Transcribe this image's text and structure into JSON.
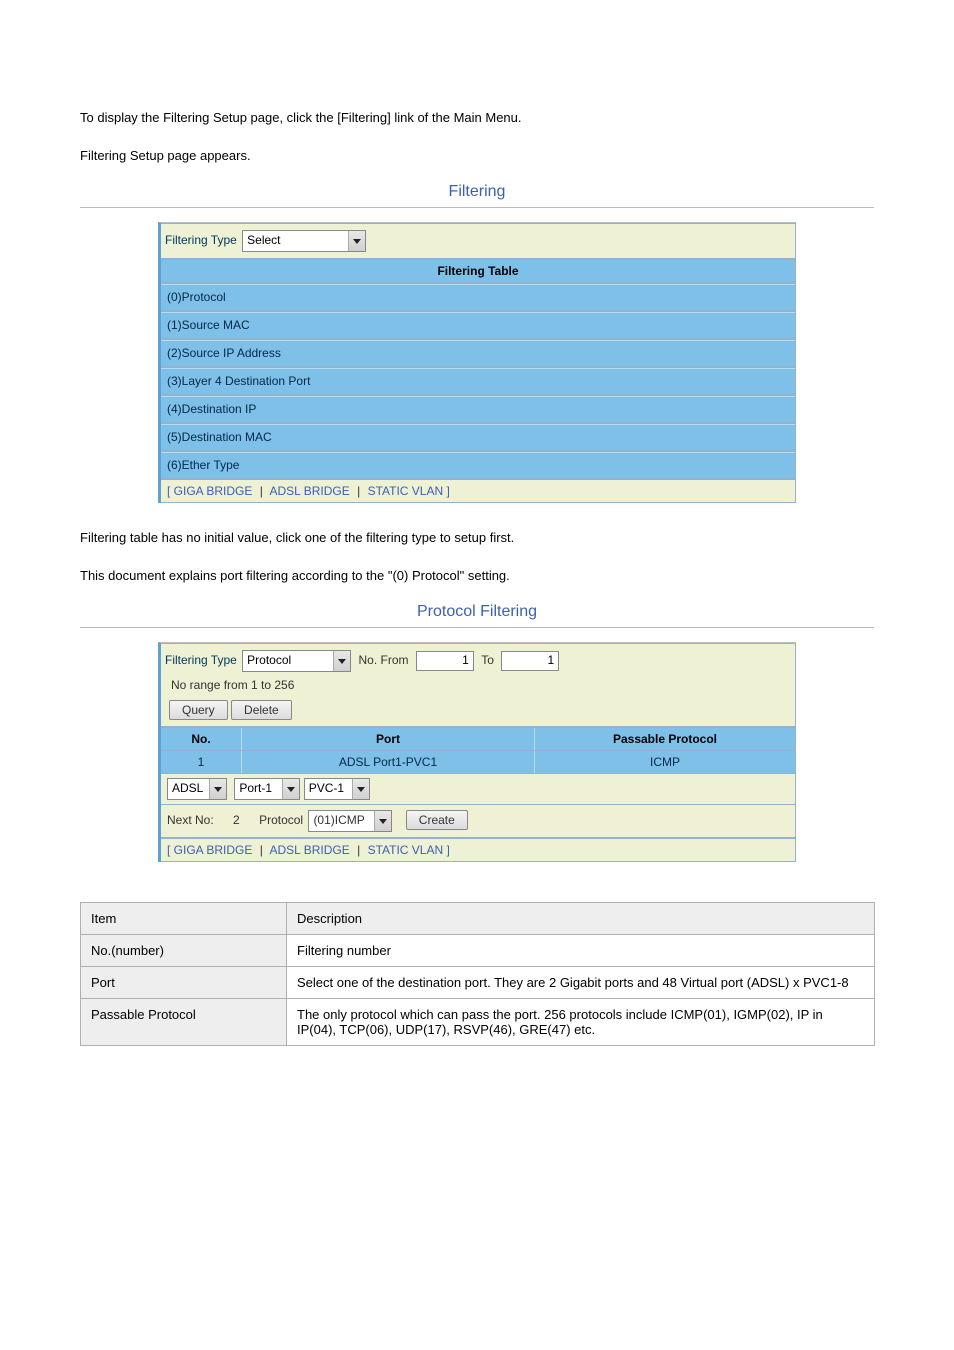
{
  "intro": {
    "line1": "To display the Filtering Setup page, click the [Filtering] link of the Main Menu.",
    "line2": "Filtering Setup page appears."
  },
  "panel1": {
    "title": "Filtering",
    "filteringTypeLabel": "Filtering Type",
    "filteringTypeValue": "Select",
    "tableTitle": "Filtering Table",
    "rows": [
      "(0)Protocol",
      "(1)Source MAC",
      "(2)Source IP Address",
      "(3)Layer 4 Destination Port",
      "(4)Destination IP",
      "(5)Destination MAC",
      "(6)Ether Type"
    ],
    "footer": {
      "bracketOpen": "[ ",
      "link1": "GIGA BRIDGE",
      "link2": "ADSL BRIDGE",
      "link3": "STATIC VLAN",
      "bracketClose": " ]"
    }
  },
  "mid": {
    "line1": "Filtering table has no initial value, click one of the filtering type to setup first.",
    "line2": "This document explains port filtering according to the \"(0) Protocol\" setting."
  },
  "panel2": {
    "title": "Protocol Filtering",
    "filteringTypeLabel": "Filtering Type",
    "filteringTypeValue": "Protocol",
    "noFromLabel": "No. From",
    "noFromValue": "1",
    "toLabel": "To",
    "toValue": "1",
    "rangeHint": "No range from 1 to 256",
    "queryBtn": "Query",
    "deleteBtn": "Delete",
    "headers": {
      "no": "No.",
      "port": "Port",
      "prot": "Passable Protocol"
    },
    "dataRow": {
      "no": "1",
      "port": "ADSL Port1-PVC1",
      "prot": "ICMP"
    },
    "selects": {
      "adsl": "ADSL",
      "port": "Port-1",
      "pvc": "PVC-1"
    },
    "nextNoLabel": "Next No:",
    "nextNoVal": "2",
    "protocolLabel": "Protocol",
    "protocolValue": "(01)ICMP",
    "createBtn": "Create",
    "footer": {
      "bracketOpen": "[ ",
      "link1": "GIGA BRIDGE",
      "link2": "ADSL BRIDGE",
      "link3": "STATIC VLAN",
      "bracketClose": " ]"
    }
  },
  "docTable": {
    "hItem": "Item",
    "hDesc": "Description",
    "r1Item": "No.(number)",
    "r1Desc": "Filtering number",
    "r2Item": "Port",
    "r2Desc": "Select one of the destination port. They are 2 Gigabit ports and 48 Virtual port (ADSL) x PVC1-8",
    "r3Item": "Passable Protocol",
    "r3Desc": "The only protocol which can pass the port. 256 protocols include ICMP(01), IGMP(02), IP in IP(04), TCP(06), UDP(17), RSVP(46), GRE(47) etc."
  }
}
